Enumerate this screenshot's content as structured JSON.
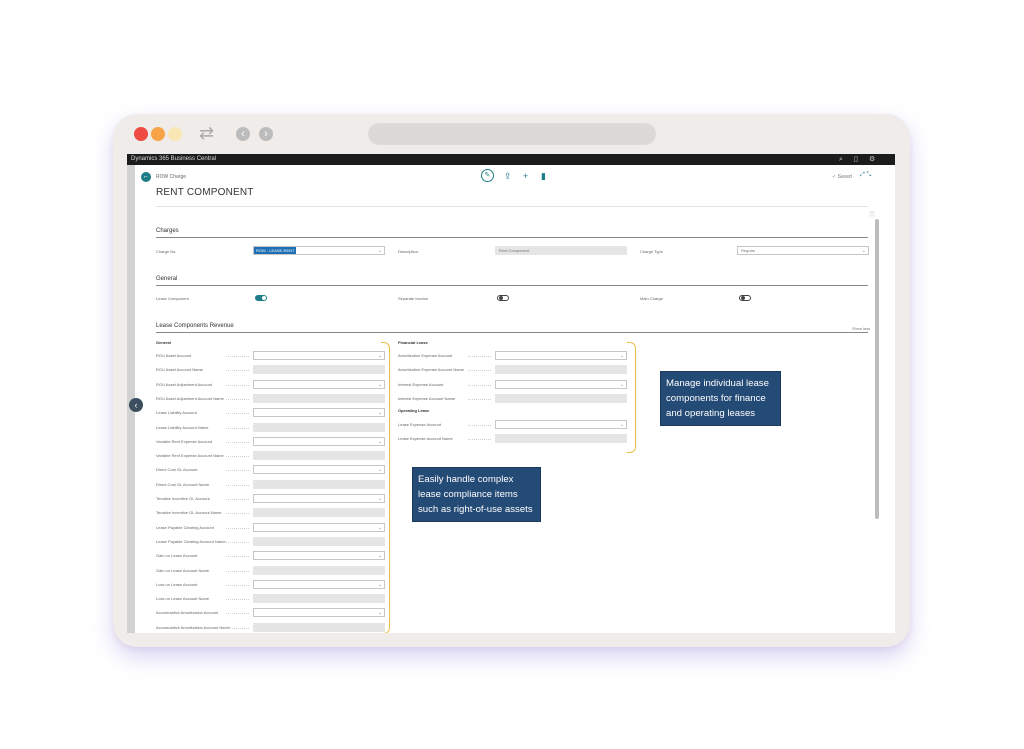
{
  "browser": {
    "icons": [
      "sync-icon",
      "back-icon",
      "forward-icon"
    ]
  },
  "app": {
    "title": "Dynamics 365 Business Central"
  },
  "page": {
    "breadcrumb": "ROW Charge",
    "title": "RENT COMPONENT",
    "saved": "✓ Saved"
  },
  "sections": {
    "charges": "Charges",
    "general": "General",
    "revenue": "Lease Components Revenue",
    "show_less": "Show less"
  },
  "charges": {
    "charge_no_label": "Charge No.",
    "charge_no_value": "ROW - LEASE-RENT",
    "description_label": "Description",
    "description_value": "Rent Component",
    "charge_type_label": "Charge Type",
    "charge_type_value": "Regular"
  },
  "general": {
    "lease_component": "Lease Component",
    "separate_invoice": "Separate Invoice",
    "main_charge": "Main Charge"
  },
  "revenue": {
    "general_head": "General",
    "general_fields": [
      "ROU Asset Account",
      "ROU Asset Account Name",
      "ROU Asset Adjustment Account",
      "ROU Asset Adjustment Account Name",
      "Lease Liability Account",
      "Lease Liability Account Name",
      "Variable Rent Expense Account",
      "Variable Rent Expense Account Name",
      "Direct Cost GL Account",
      "Direct Cost GL Account Name",
      "Tenatice Incentive GL Account",
      "Tenatice Incentive GL Account Name",
      "Lease Payable Clearing Account",
      "Lease Payable Clearing Account Name",
      "Gain on Lease Account",
      "Gain on Lease Account Name",
      "Loss on Lease Account",
      "Loss on Lease Account Name",
      "Accumulative Amortization Account",
      "Accumulative Amortization Account Name"
    ],
    "financial_head": "Financial Lease",
    "financial_fields": [
      "Amortization Expense Account",
      "Amortization Expense Account Name",
      "Interest Expense Account",
      "Interest Expense Account Name"
    ],
    "operating_head": "Operating Lease",
    "operating_fields": [
      "Lease Expense Account",
      "Lease Expense Account Name"
    ]
  },
  "callouts": {
    "manage": "Manage individual lease components for finance and operating leases",
    "easily": "Easily handle complex lease compliance items such as right-of-use assets"
  },
  "colors": {
    "accent": "#1f7d88",
    "callout": "#244a76",
    "bracket": "#e8c04a"
  }
}
